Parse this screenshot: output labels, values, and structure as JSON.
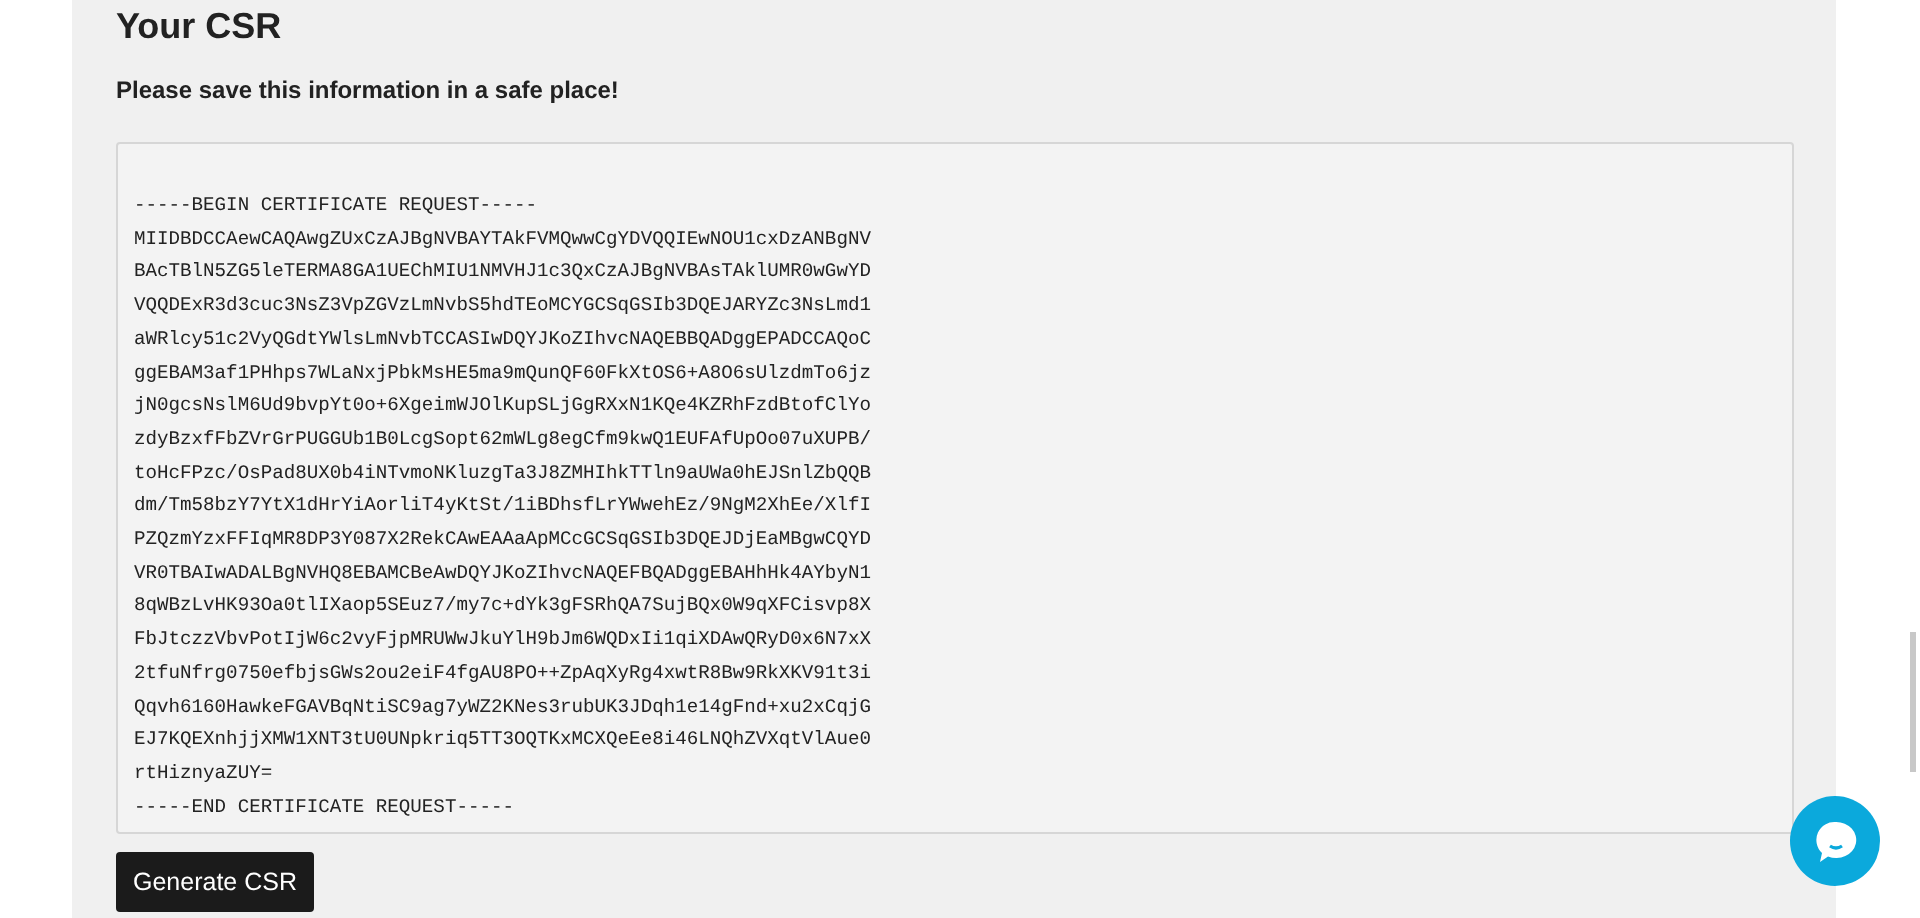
{
  "heading": "Your CSR",
  "notice": "Please save this information in a safe place!",
  "csr_field": {
    "lines": [
      "-----BEGIN CERTIFICATE REQUEST-----",
      "MIIDBDCCAewCAQAwgZUxCzAJBgNVBAYTAkFVMQwwCgYDVQQIEwNOU1cxDzANBgNV",
      "BAcTBlN5ZG5leTERMA8GA1UEChMIU1NMVHJ1c3QxCzAJBgNVBAsTAklUMR0wGwYD",
      "VQQDExR3d3cuc3NsZ3VpZGVzLmNvbS5hdTEoMCYGCSqGSIb3DQEJARYZc3NsLmd1",
      "aWRlcy51c2VyQGdtYWlsLmNvbTCCASIwDQYJKoZIhvcNAQEBBQADggEPADCCAQoC",
      "ggEBAM3af1PHhps7WLaNxjPbkMsHE5ma9mQunQF60FkXtOS6+A8O6sUlzdmTo6jz",
      "jN0gcsNslM6Ud9bvpYt0o+6XgeimWJOlKupSLjGgRXxN1KQe4KZRhFzdBtofClYo",
      "zdyBzxfFbZVrGrPUGGUb1B0LcgSopt62mWLg8egCfm9kwQ1EUFAfUpOo07uXUPB/",
      "toHcFPzc/OsPad8UX0b4iNTvmoNKluzgTa3J8ZMHIhkTTln9aUWa0hEJSnlZbQQB",
      "dm/Tm58bzY7YtX1dHrYiAorliT4yKtSt/1iBDhsfLrYWwehEz/9NgM2XhEe/XlfI",
      "PZQzmYzxFFIqMR8DP3Y087X2RekCAwEAAaApMCcGCSqGSIb3DQEJDjEaMBgwCQYD",
      "VR0TBAIwADALBgNVHQ8EBAMCBeAwDQYJKoZIhvcNAQEFBQADggEBAHhHk4AYbyN1",
      "8qWBzLvHK93Oa0tlIXaop5SEuz7/my7c+dYk3gFSRhQA7SujBQx0W9qXFCisvp8X",
      "FbJtczzVbvPotIjW6c2vyFjpMRUWwJkuYlH9bJm6WQDxIi1qiXDAwQRyD0x6N7xX",
      "2tfuNfrg0750efbjsGWs2ou2eiF4fgAU8PO++ZpAqXyRg4xwtR8Bw9RkXKV91t3i",
      "Qqvh6160HawkeFGAVBqNtiSC9ag7yWZ2KNes3rubUK3JDqh1e14gFnd+xu2xCqjG",
      "EJ7KQEXnhjjXMW1XNT3tU0UNpkriq5TT3OQTKxMCXQeEe8i46LNQhZVXqtVlAue0",
      "rtHiznyaZUY=",
      "-----END CERTIFICATE REQUEST-----"
    ]
  },
  "generate_button": {
    "label": "Generate CSR"
  }
}
